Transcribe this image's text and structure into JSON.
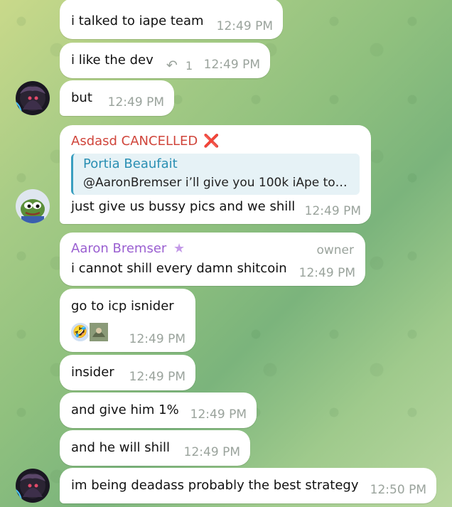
{
  "messages": [
    {
      "text": "i talked to iape team",
      "time": "12:49 PM"
    },
    {
      "text": "i like the dev",
      "time": "12:49 PM",
      "replies": "1"
    },
    {
      "text": "but",
      "time": "12:49 PM"
    },
    {
      "sender": "Asdasd CANCELLED",
      "sender_color": "#d0453b",
      "quote_name": "Portia Beaufait",
      "quote_text": "@AaronBremser i’ll give you 100k iApe to…",
      "text": "just give us bussy pics and we shill",
      "time": "12:49 PM"
    },
    {
      "sender": "Aaron Bremser",
      "sender_color": "#9a5fd1",
      "role": "owner",
      "text": "i cannot shill every damn shitcoin",
      "time": "12:49 PM"
    },
    {
      "text": "go to icp isnider",
      "time": "12:49 PM",
      "reaction": "🤣"
    },
    {
      "text": "insider",
      "time": "12:49 PM"
    },
    {
      "text": "and give him 1%",
      "time": "12:49 PM"
    },
    {
      "text": "and he will shill",
      "time": "12:49 PM"
    },
    {
      "text": "im being deadass probably the best strategy",
      "time": "12:50 PM"
    }
  ],
  "icons": {
    "cancel_mark": "❌",
    "star": "★",
    "reply_arrow": "↶"
  },
  "colors": {
    "bubble": "#ffffff",
    "time": "#9aa39c",
    "quote_bar": "#3a9fc0"
  }
}
